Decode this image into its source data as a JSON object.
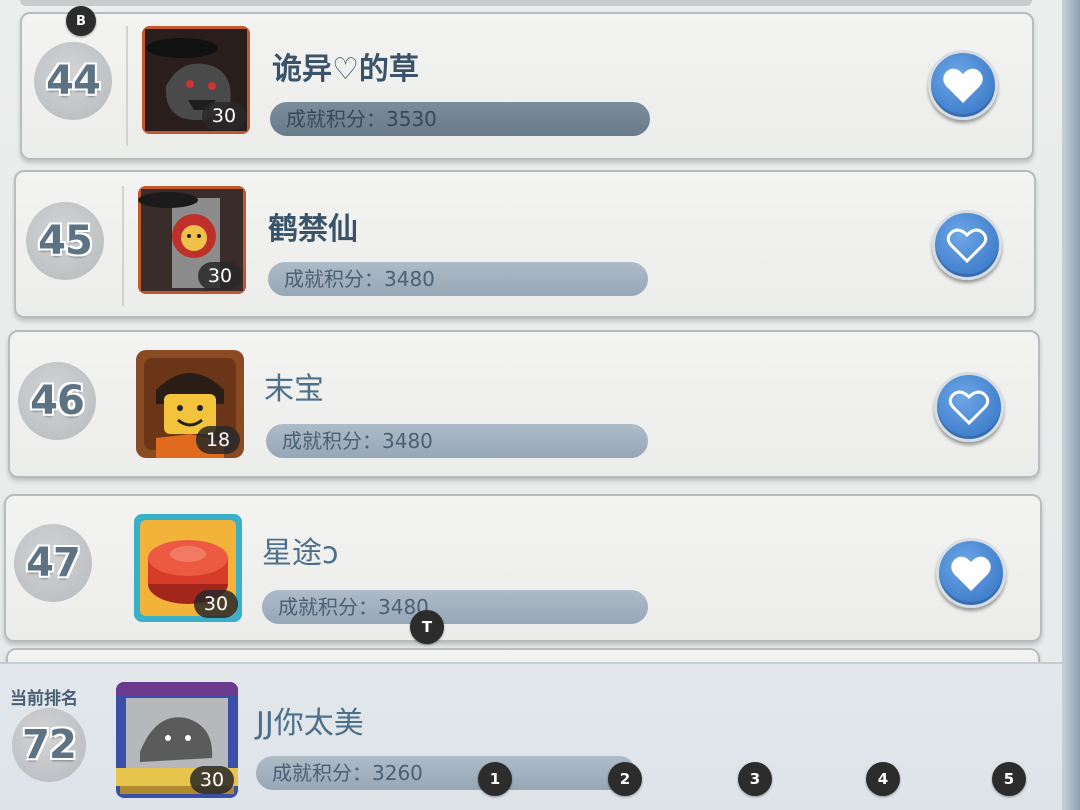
{
  "leaderboard": {
    "rows": [
      {
        "rank": "44",
        "name": "诡异♡的草",
        "level": "30",
        "score_text": "成就积分：3530",
        "liked": true
      },
      {
        "rank": "45",
        "name": "鹤禁仙",
        "level": "30",
        "score_text": "成就积分：3480",
        "liked": false
      },
      {
        "rank": "46",
        "name": "末宝",
        "level": "18",
        "score_text": "成就积分：3480",
        "liked": false
      },
      {
        "rank": "47",
        "name": "星途ↄ",
        "level": "30",
        "score_text": "成就积分：3480",
        "liked": true
      }
    ]
  },
  "current_user": {
    "label": "当前排名",
    "rank": "72",
    "name": "JJ你太美",
    "level": "30",
    "score_text": "成就积分：3260"
  },
  "markers": {
    "b": "B",
    "t": "T",
    "m1": "1",
    "m2": "2",
    "m3": "3",
    "m4": "4",
    "m5": "5"
  },
  "colors": {
    "heart_button": "#3b7bcc",
    "rank_text": "#5d7283",
    "score_bar": "#9fb0bf"
  },
  "icons": {
    "like": "heart-icon"
  }
}
